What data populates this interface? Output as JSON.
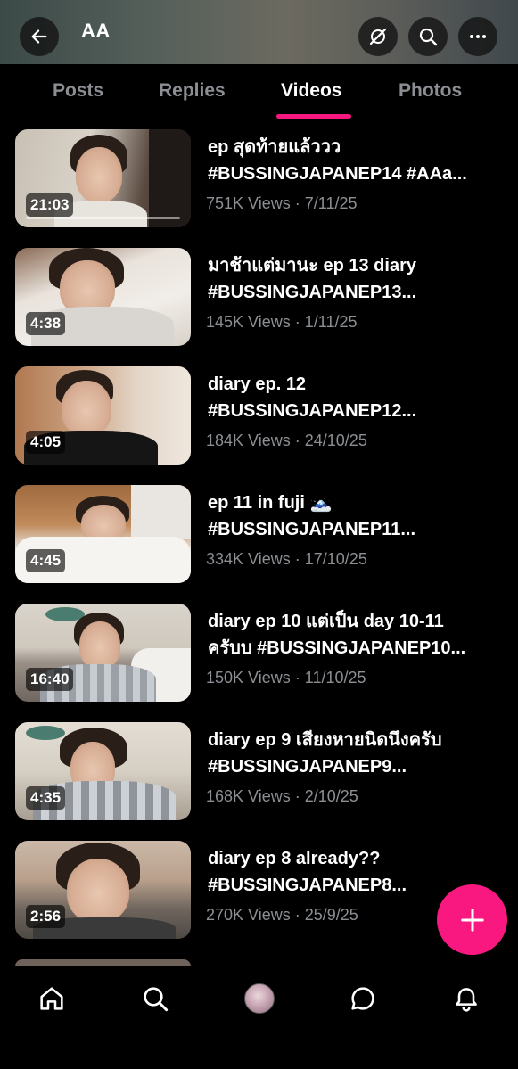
{
  "header": {
    "title": "AA",
    "back_icon": "arrow-left-icon",
    "grok_icon": "slash-circle-icon",
    "search_icon": "search-icon",
    "more_icon": "more-horizontal-icon"
  },
  "tabs": [
    {
      "label": "Posts",
      "active": false
    },
    {
      "label": "Replies",
      "active": false
    },
    {
      "label": "Videos",
      "active": true
    },
    {
      "label": "Photos",
      "active": false
    }
  ],
  "accent_color": "#f91880",
  "videos": [
    {
      "line1": "ep สุดท้ายแล้ววว",
      "line2": "#BUSSINGJAPANEP14 #AAa...",
      "duration": "21:03",
      "views": "751K Views",
      "date": "7/11/25"
    },
    {
      "line1": "มาช้าแต่มานะ ep 13 diary",
      "line2": "#BUSSINGJAPANEP13...",
      "duration": "4:38",
      "views": "145K Views",
      "date": "1/11/25"
    },
    {
      "line1": "diary ep. 12",
      "line2": "#BUSSINGJAPANEP12...",
      "duration": "4:05",
      "views": "184K Views",
      "date": "24/10/25"
    },
    {
      "line1": "ep 11 in fuji 🗻",
      "line2": "#BUSSINGJAPANEP11...",
      "duration": "4:45",
      "views": "334K Views",
      "date": "17/10/25"
    },
    {
      "line1": "diary ep 10 แต่เป็น day 10-11",
      "line2": "ครับบ #BUSSINGJAPANEP10...",
      "duration": "16:40",
      "views": "150K Views",
      "date": "11/10/25"
    },
    {
      "line1": "diary ep 9 เสียงหายนิดนึงครับ",
      "line2": "#BUSSINGJAPANEP9...",
      "duration": "4:35",
      "views": "168K Views",
      "date": "2/10/25"
    },
    {
      "line1": "diary ep 8 already??",
      "line2": "#BUSSINGJAPANEP8...",
      "duration": "2:56",
      "views": "270K Views",
      "date": "25/9/25"
    }
  ],
  "separator": "·",
  "fab": {
    "icon": "plus-icon"
  },
  "bottom_nav": [
    {
      "icon": "home-icon"
    },
    {
      "icon": "search-icon"
    },
    {
      "icon": "avatar"
    },
    {
      "icon": "chat-bubble-icon"
    },
    {
      "icon": "bell-icon"
    }
  ]
}
